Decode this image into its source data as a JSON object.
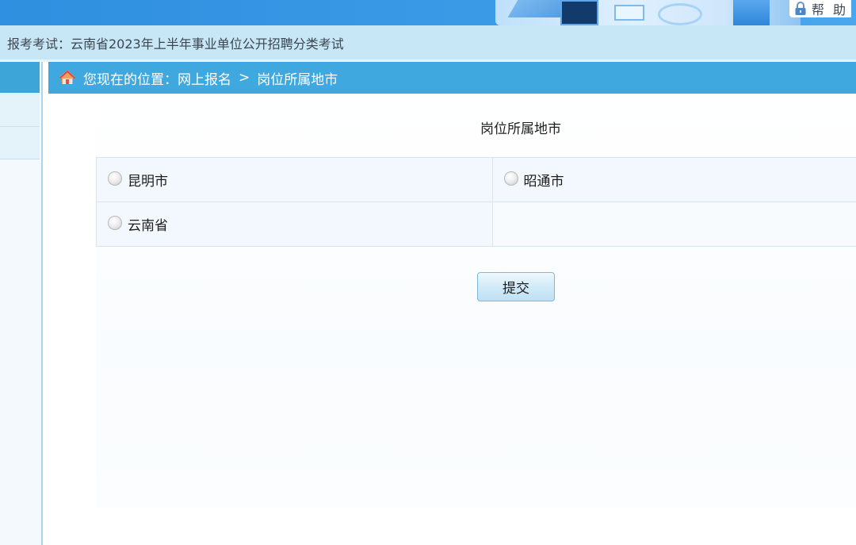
{
  "header": {
    "help_label": "帮 助",
    "icons": {
      "help": "lock-icon"
    }
  },
  "exam_bar": {
    "text": "报考考试：云南省2023年上半年事业单位公开招聘分类考试"
  },
  "breadcrumb": {
    "icon": "home-icon",
    "prefix": "您现在的位置：网上报名",
    "separator": ">",
    "current": "岗位所属地市"
  },
  "main": {
    "section_title": "岗位所属地市",
    "options": [
      {
        "label": "昆明市",
        "selected": false
      },
      {
        "label": "昭通市",
        "selected": false
      },
      {
        "label": "云南省",
        "selected": false
      }
    ],
    "submit_label": "提交"
  },
  "colors": {
    "banner_blue": "#3a9ae6",
    "exam_bar_bg": "#c7e7f6",
    "breadcrumb_bg": "#3fa8de",
    "table_border": "#d3e7f3",
    "table_cell_bg": "#f2f8fd"
  }
}
